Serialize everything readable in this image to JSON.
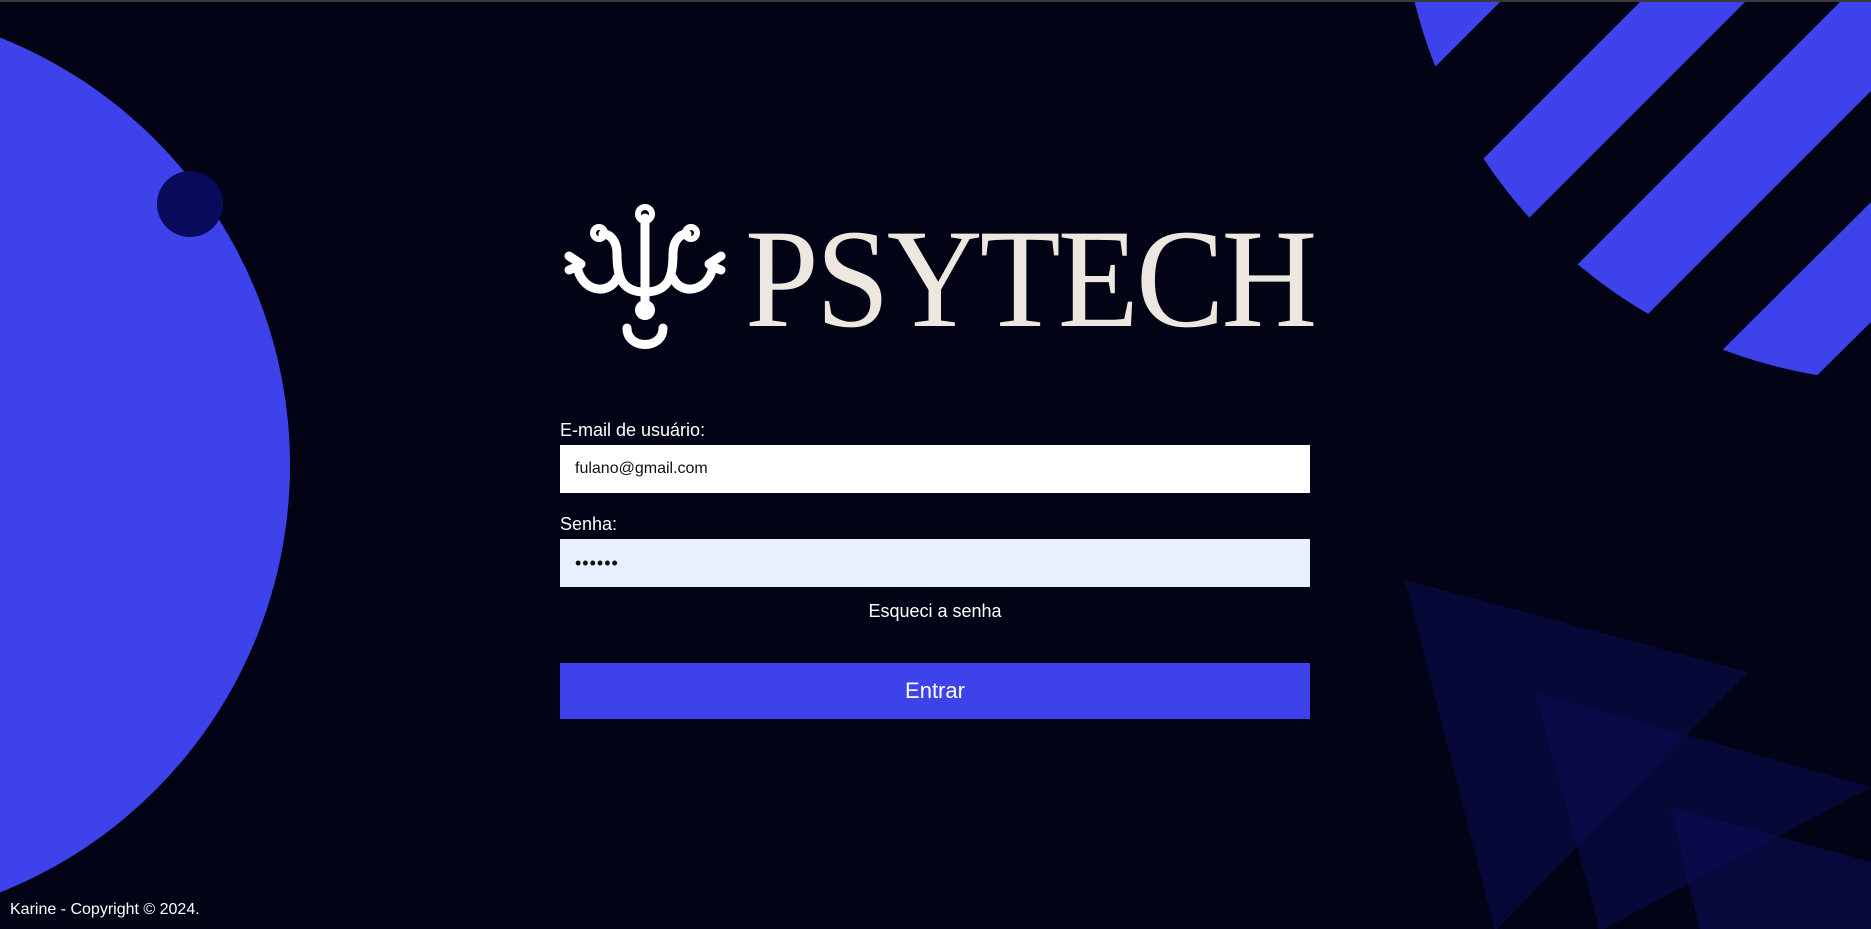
{
  "brand": {
    "name": "PSYTECH"
  },
  "login": {
    "email_label": "E-mail de usuário:",
    "email_value": "fulano@gmail.com",
    "password_label": "Senha:",
    "password_value": "••••••",
    "forgot_link": "Esqueci a senha",
    "submit_label": "Entrar"
  },
  "footer": {
    "copyright": "Karine - Copyright © 2024."
  },
  "colors": {
    "background": "#020314",
    "accent": "#3d42ea",
    "dark_accent": "#0a0a5c",
    "logo": "#ede8df",
    "password_bg": "#e8f0fd"
  },
  "icons": {
    "logo_mark": "psi-symbol-icon"
  }
}
